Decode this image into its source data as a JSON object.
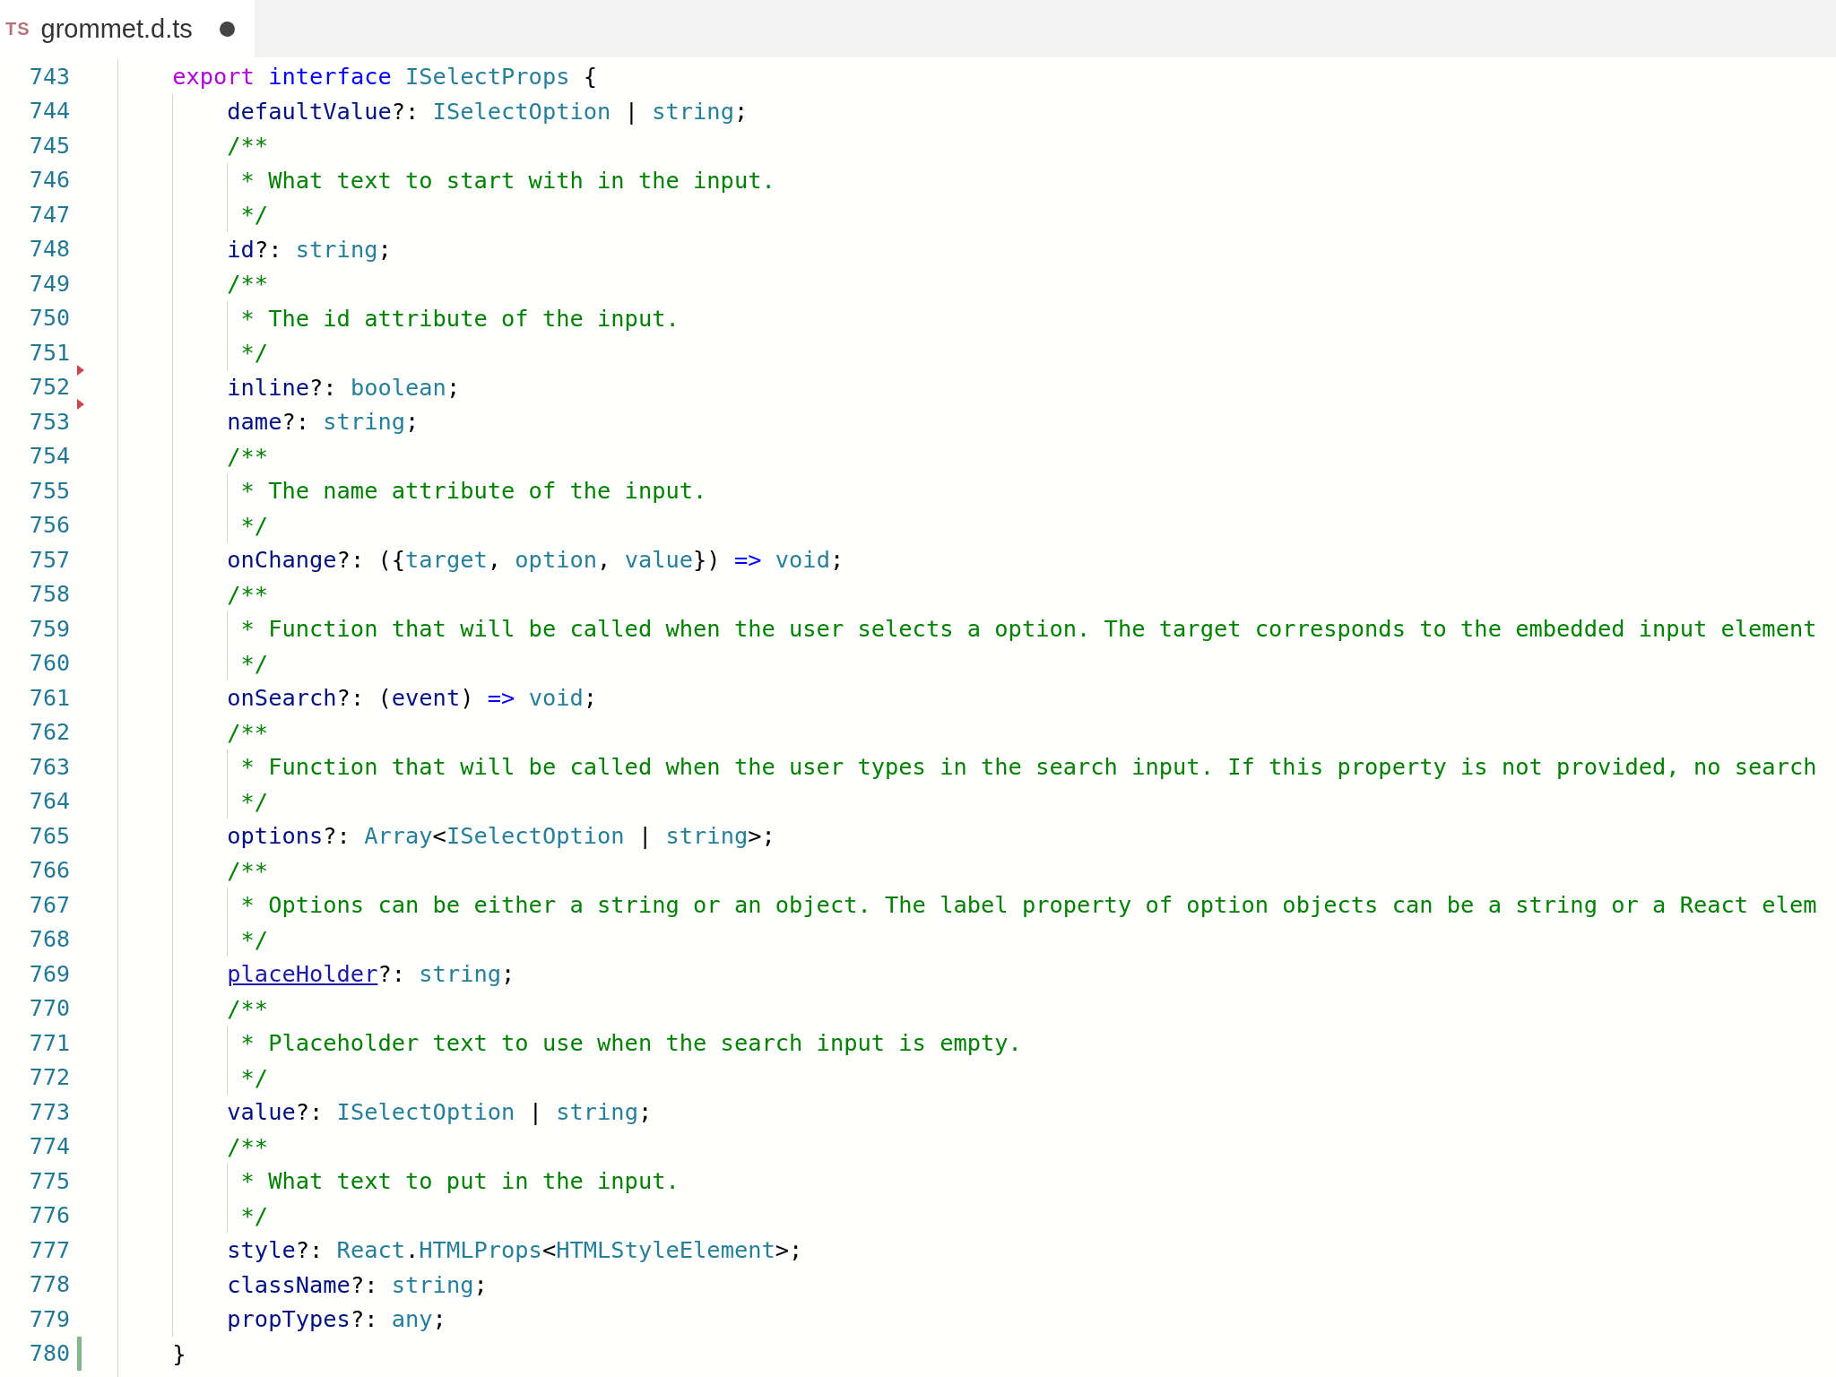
{
  "tab": {
    "icon_text": "TS",
    "title": "grommet.d.ts",
    "unsaved": true,
    "selected": true
  },
  "lines": [
    {
      "number": "743",
      "kind": "plain",
      "tokens": [
        {
          "kind": "kw",
          "s": "    export"
        },
        {
          "kind": "storage",
          "s": " interface"
        },
        {
          "kind": "type",
          "s": " ISelectProps"
        },
        {
          "kind": "punct",
          "s": " {"
        }
      ]
    },
    {
      "number": "744",
      "kind": "plain",
      "tokens": [
        {
          "kind": "var",
          "s": "        defaultValue"
        },
        {
          "kind": "punct",
          "s": "?: "
        },
        {
          "kind": "type",
          "s": "ISelectOption"
        },
        {
          "kind": "punct",
          "s": " | "
        },
        {
          "kind": "type",
          "s": "string"
        },
        {
          "kind": "punct",
          "s": ";"
        }
      ]
    },
    {
      "number": "745",
      "kind": "plain",
      "tokens": [
        {
          "kind": "comment",
          "s": "        /**"
        }
      ]
    },
    {
      "number": "746",
      "kind": "plain",
      "tokens": [
        {
          "kind": "comment",
          "s": "         * What text to start with in the input."
        }
      ]
    },
    {
      "number": "747",
      "kind": "plain",
      "tokens": [
        {
          "kind": "comment",
          "s": "         */"
        }
      ]
    },
    {
      "number": "748",
      "kind": "plain",
      "tokens": [
        {
          "kind": "var",
          "s": "        id"
        },
        {
          "kind": "punct",
          "s": "?: "
        },
        {
          "kind": "type",
          "s": "string"
        },
        {
          "kind": "punct",
          "s": ";"
        }
      ]
    },
    {
      "number": "749",
      "kind": "plain",
      "tokens": [
        {
          "kind": "comment",
          "s": "        /**"
        }
      ]
    },
    {
      "number": "750",
      "kind": "plain",
      "tokens": [
        {
          "kind": "comment",
          "s": "         * The id attribute of the input."
        }
      ]
    },
    {
      "number": "751",
      "kind": "plain",
      "tokens": [
        {
          "kind": "comment",
          "s": "         */"
        }
      ]
    },
    {
      "number": "752",
      "kind": "deleted",
      "tokens": [
        {
          "kind": "var",
          "s": "        inline"
        },
        {
          "kind": "punct",
          "s": "?: "
        },
        {
          "kind": "type",
          "s": "boolean"
        },
        {
          "kind": "punct",
          "s": ";"
        }
      ]
    },
    {
      "number": "753",
      "kind": "deleted",
      "tokens": [
        {
          "kind": "var",
          "s": "        name"
        },
        {
          "kind": "punct",
          "s": "?: "
        },
        {
          "kind": "type",
          "s": "string"
        },
        {
          "kind": "punct",
          "s": ";"
        }
      ]
    },
    {
      "number": "754",
      "kind": "plain",
      "tokens": [
        {
          "kind": "comment",
          "s": "        /**"
        }
      ]
    },
    {
      "number": "755",
      "kind": "plain",
      "tokens": [
        {
          "kind": "comment",
          "s": "         * The name attribute of the input."
        }
      ]
    },
    {
      "number": "756",
      "kind": "plain",
      "tokens": [
        {
          "kind": "comment",
          "s": "         */"
        }
      ]
    },
    {
      "number": "757",
      "kind": "plain",
      "tokens": [
        {
          "kind": "var",
          "s": "        onChange"
        },
        {
          "kind": "punct",
          "s": "?: ({"
        },
        {
          "kind": "type",
          "s": "target"
        },
        {
          "kind": "punct",
          "s": ", "
        },
        {
          "kind": "type",
          "s": "option"
        },
        {
          "kind": "punct",
          "s": ", "
        },
        {
          "kind": "type",
          "s": "value"
        },
        {
          "kind": "punct",
          "s": "}) "
        },
        {
          "kind": "storage",
          "s": "=>"
        },
        {
          "kind": "type",
          "s": " void"
        },
        {
          "kind": "punct",
          "s": ";"
        }
      ]
    },
    {
      "number": "758",
      "kind": "plain",
      "tokens": [
        {
          "kind": "comment",
          "s": "        /**"
        }
      ]
    },
    {
      "number": "759",
      "kind": "plain",
      "tokens": [
        {
          "kind": "comment",
          "s": "         * Function that will be called when the user selects a option. The target corresponds to the embedded input element"
        }
      ]
    },
    {
      "number": "760",
      "kind": "plain",
      "tokens": [
        {
          "kind": "comment",
          "s": "         */"
        }
      ]
    },
    {
      "number": "761",
      "kind": "plain",
      "tokens": [
        {
          "kind": "var",
          "s": "        onSearch"
        },
        {
          "kind": "punct",
          "s": "?: ("
        },
        {
          "kind": "var",
          "s": "event"
        },
        {
          "kind": "punct",
          "s": ") "
        },
        {
          "kind": "storage",
          "s": "=>"
        },
        {
          "kind": "type",
          "s": " void"
        },
        {
          "kind": "punct",
          "s": ";"
        }
      ]
    },
    {
      "number": "762",
      "kind": "plain",
      "tokens": [
        {
          "kind": "comment",
          "s": "        /**"
        }
      ]
    },
    {
      "number": "763",
      "kind": "plain",
      "tokens": [
        {
          "kind": "comment",
          "s": "         * Function that will be called when the user types in the search input. If this property is not provided, no search"
        }
      ]
    },
    {
      "number": "764",
      "kind": "plain",
      "tokens": [
        {
          "kind": "comment",
          "s": "         */"
        }
      ]
    },
    {
      "number": "765",
      "kind": "plain",
      "tokens": [
        {
          "kind": "var",
          "s": "        options"
        },
        {
          "kind": "punct",
          "s": "?: "
        },
        {
          "kind": "type",
          "s": "Array"
        },
        {
          "kind": "punct",
          "s": "<"
        },
        {
          "kind": "type",
          "s": "ISelectOption"
        },
        {
          "kind": "punct",
          "s": " | "
        },
        {
          "kind": "type",
          "s": "string"
        },
        {
          "kind": "punct",
          "s": ">;"
        }
      ]
    },
    {
      "number": "766",
      "kind": "plain",
      "tokens": [
        {
          "kind": "comment",
          "s": "        /**"
        }
      ]
    },
    {
      "number": "767",
      "kind": "plain",
      "tokens": [
        {
          "kind": "comment",
          "s": "         * Options can be either a string or an object. The label property of option objects can be a string or a React elem"
        }
      ]
    },
    {
      "number": "768",
      "kind": "plain",
      "tokens": [
        {
          "kind": "comment",
          "s": "         */"
        }
      ]
    },
    {
      "number": "769",
      "kind": "plain",
      "tokens": [
        {
          "kind": "link",
          "s": "        placeHolder"
        },
        {
          "kind": "punct",
          "s": "?: "
        },
        {
          "kind": "type",
          "s": "string"
        },
        {
          "kind": "punct",
          "s": ";"
        }
      ]
    },
    {
      "number": "770",
      "kind": "plain",
      "tokens": [
        {
          "kind": "comment",
          "s": "        /**"
        }
      ]
    },
    {
      "number": "771",
      "kind": "plain",
      "tokens": [
        {
          "kind": "comment",
          "s": "         * Placeholder text to use when the search input is empty."
        }
      ]
    },
    {
      "number": "772",
      "kind": "plain",
      "tokens": [
        {
          "kind": "comment",
          "s": "         */"
        }
      ]
    },
    {
      "number": "773",
      "kind": "plain",
      "tokens": [
        {
          "kind": "var",
          "s": "        value"
        },
        {
          "kind": "punct",
          "s": "?: "
        },
        {
          "kind": "type",
          "s": "ISelectOption"
        },
        {
          "kind": "punct",
          "s": " | "
        },
        {
          "kind": "type",
          "s": "string"
        },
        {
          "kind": "punct",
          "s": ";"
        }
      ]
    },
    {
      "number": "774",
      "kind": "plain",
      "tokens": [
        {
          "kind": "comment",
          "s": "        /**"
        }
      ]
    },
    {
      "number": "775",
      "kind": "plain",
      "tokens": [
        {
          "kind": "comment",
          "s": "         * What text to put in the input."
        }
      ]
    },
    {
      "number": "776",
      "kind": "plain",
      "tokens": [
        {
          "kind": "comment",
          "s": "         */"
        }
      ]
    },
    {
      "number": "777",
      "kind": "plain",
      "tokens": [
        {
          "kind": "var",
          "s": "        style"
        },
        {
          "kind": "punct",
          "s": "?: "
        },
        {
          "kind": "type",
          "s": "React"
        },
        {
          "kind": "punct",
          "s": "."
        },
        {
          "kind": "type",
          "s": "HTMLProps"
        },
        {
          "kind": "punct",
          "s": "<"
        },
        {
          "kind": "type",
          "s": "HTMLStyleElement"
        },
        {
          "kind": "punct",
          "s": ">;"
        }
      ]
    },
    {
      "number": "778",
      "kind": "plain",
      "tokens": [
        {
          "kind": "var",
          "s": "        className"
        },
        {
          "kind": "punct",
          "s": "?: "
        },
        {
          "kind": "type",
          "s": "string"
        },
        {
          "kind": "punct",
          "s": ";"
        }
      ]
    },
    {
      "number": "779",
      "kind": "plain",
      "tokens": [
        {
          "kind": "var",
          "s": "        propTypes"
        },
        {
          "kind": "punct",
          "s": "?: "
        },
        {
          "kind": "type",
          "s": "any"
        },
        {
          "kind": "punct",
          "s": ";"
        }
      ]
    },
    {
      "number": "780",
      "kind": "added",
      "tokens": [
        {
          "kind": "punct",
          "s": "    }"
        }
      ]
    }
  ]
}
